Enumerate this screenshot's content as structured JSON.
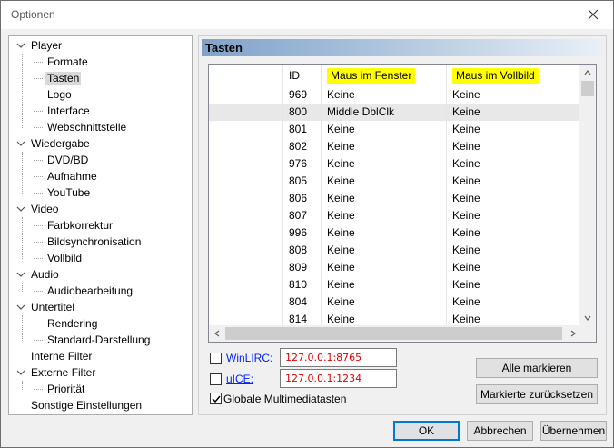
{
  "window": {
    "title": "Optionen"
  },
  "tree": {
    "items": [
      {
        "label": "Player",
        "level": 0,
        "expanded": true
      },
      {
        "label": "Formate",
        "level": 1
      },
      {
        "label": "Tasten",
        "level": 1,
        "selected": true
      },
      {
        "label": "Logo",
        "level": 1
      },
      {
        "label": "Interface",
        "level": 1
      },
      {
        "label": "Webschnittstelle",
        "level": 1
      },
      {
        "label": "Wiedergabe",
        "level": 0,
        "expanded": true
      },
      {
        "label": "DVD/BD",
        "level": 1
      },
      {
        "label": "Aufnahme",
        "level": 1
      },
      {
        "label": "YouTube",
        "level": 1
      },
      {
        "label": "Video",
        "level": 0,
        "expanded": true
      },
      {
        "label": "Farbkorrektur",
        "level": 1
      },
      {
        "label": "Bildsynchronisation",
        "level": 1
      },
      {
        "label": "Vollbild",
        "level": 1
      },
      {
        "label": "Audio",
        "level": 0,
        "expanded": true
      },
      {
        "label": "Audiobearbeitung",
        "level": 1
      },
      {
        "label": "Untertitel",
        "level": 0,
        "expanded": true
      },
      {
        "label": "Rendering",
        "level": 1
      },
      {
        "label": "Standard-Darstellung",
        "level": 1
      },
      {
        "label": "Interne Filter",
        "level": 0
      },
      {
        "label": "Externe Filter",
        "level": 0,
        "expanded": true
      },
      {
        "label": "Priorität",
        "level": 1
      },
      {
        "label": "Sonstige Einstellungen",
        "level": 0
      }
    ]
  },
  "panel": {
    "title": "Tasten",
    "table": {
      "headers": [
        "",
        "ID",
        "Maus im Fenster",
        "Maus im Vollbild"
      ],
      "highlight_color": "#ffff00",
      "rows": [
        {
          "id": "969",
          "window": "Keine",
          "fullscreen": "Keine"
        },
        {
          "id": "800",
          "window": "Middle DblClk",
          "fullscreen": "Keine"
        },
        {
          "id": "801",
          "window": "Keine",
          "fullscreen": "Keine"
        },
        {
          "id": "802",
          "window": "Keine",
          "fullscreen": "Keine"
        },
        {
          "id": "976",
          "window": "Keine",
          "fullscreen": "Keine"
        },
        {
          "id": "805",
          "window": "Keine",
          "fullscreen": "Keine"
        },
        {
          "id": "806",
          "window": "Keine",
          "fullscreen": "Keine"
        },
        {
          "id": "807",
          "window": "Keine",
          "fullscreen": "Keine"
        },
        {
          "id": "996",
          "window": "Keine",
          "fullscreen": "Keine"
        },
        {
          "id": "808",
          "window": "Keine",
          "fullscreen": "Keine"
        },
        {
          "id": "809",
          "window": "Keine",
          "fullscreen": "Keine"
        },
        {
          "id": "810",
          "window": "Keine",
          "fullscreen": "Keine"
        },
        {
          "id": "804",
          "window": "Keine",
          "fullscreen": "Keine"
        },
        {
          "id": "814",
          "window": "Keine",
          "fullscreen": "Keine"
        }
      ]
    },
    "winlirc": {
      "label": "WinLIRC:",
      "value": "127.0.0.1:8765",
      "checked": false
    },
    "uice": {
      "label": "uICE:",
      "value": "127.0.0.1:1234",
      "checked": false
    },
    "global_keys": {
      "label": "Globale Multimediatasten",
      "checked": true
    },
    "select_all_label": "Alle markieren",
    "reset_selected_label": "Markierte zurücksetzen"
  },
  "footer": {
    "ok_label": "OK",
    "cancel_label": "Abbrechen",
    "apply_label": "Übernehmen"
  }
}
